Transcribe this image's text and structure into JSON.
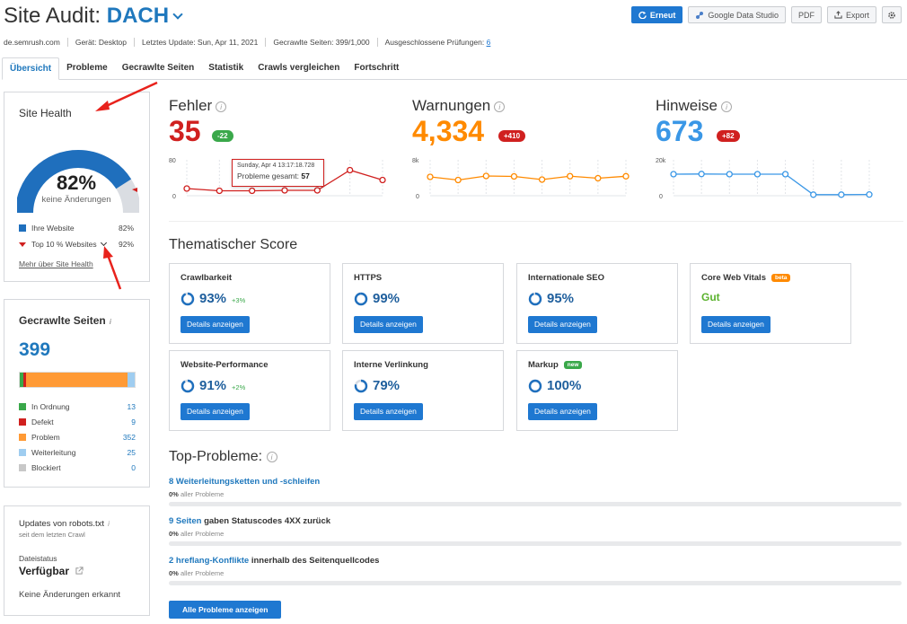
{
  "header": {
    "title_prefix": "Site Audit:",
    "project": "DACH",
    "buttons": {
      "refresh": "Erneut",
      "gds": "Google Data Studio",
      "pdf": "PDF",
      "export": "Export"
    }
  },
  "meta": {
    "domain": "de.semrush.com",
    "device": "Gerät: Desktop",
    "last_update": "Letztes Update: Sun, Apr 11, 2021",
    "crawled": "Gecrawlte Seiten: 399/1,000",
    "excluded_label": "Ausgeschlossene Prüfungen:",
    "excluded_count": "6"
  },
  "tabs": [
    "Übersicht",
    "Probleme",
    "Gecrawlte Seiten",
    "Statistik",
    "Crawls vergleichen",
    "Fortschritt"
  ],
  "site_health": {
    "title": "Site Health",
    "percent": "82%",
    "percent_value": 0.82,
    "subtitle": "keine Änderungen",
    "legend": [
      {
        "label": "Ihre Website",
        "value": "82%"
      },
      {
        "label": "Top 10 % Websites",
        "value": "92%"
      }
    ],
    "link": "Mehr über Site Health"
  },
  "crawled_pages": {
    "title": "Gecrawlte Seiten",
    "info": "i",
    "total": "399",
    "rows": [
      {
        "label": "In Ordnung",
        "value": "13",
        "color": "#3aa84a"
      },
      {
        "label": "Defekt",
        "value": "9",
        "color": "#d0201f"
      },
      {
        "label": "Problem",
        "value": "352",
        "color": "#ff9a35"
      },
      {
        "label": "Weiterleitung",
        "value": "25",
        "color": "#9fcdf0"
      },
      {
        "label": "Blockiert",
        "value": "0",
        "color": "#c8c8c8"
      }
    ]
  },
  "robots": {
    "title": "Updates von robots.txt",
    "info": "i",
    "subtitle": "seit dem letzten Crawl",
    "status_label": "Dateistatus",
    "status_value": "Verfügbar",
    "no_changes": "Keine Änderungen erkannt"
  },
  "stats": {
    "errors": {
      "label": "Fehler",
      "value": "35",
      "badge": "-22",
      "color": "#d0201f",
      "badge_color": "#3aa84a",
      "axis_top": "80",
      "axis_bottom": "0",
      "points": [
        16,
        11,
        11,
        12,
        12,
        57,
        35
      ]
    },
    "warnings": {
      "label": "Warnungen",
      "value": "4,334",
      "badge": "+410",
      "color": "#ff8a00",
      "badge_color": "#d0201f",
      "axis_top": "8k",
      "axis_bottom": "0",
      "points": [
        4200,
        3500,
        4400,
        4300,
        3600,
        4350,
        3900,
        4334
      ]
    },
    "notices": {
      "label": "Hinweise",
      "value": "673",
      "badge": "+82",
      "color": "#3a97e6",
      "badge_color": "#d0201f",
      "axis_top": "20k",
      "axis_bottom": "0",
      "points": [
        12000,
        12100,
        12000,
        12000,
        12000,
        600,
        590,
        673
      ]
    }
  },
  "tooltip": {
    "date": "Sunday, Apr 4 13:17:18.728",
    "label": "Probleme gesamt:",
    "value": "57"
  },
  "thematic": {
    "title": "Thematischer Score",
    "details_label": "Details anzeigen",
    "cards": [
      {
        "name": "Crawlbarkeit",
        "pct": "93%",
        "value": 0.93,
        "delta": "+3%"
      },
      {
        "name": "HTTPS",
        "pct": "99%",
        "value": 0.99,
        "delta": ""
      },
      {
        "name": "Internationale SEO",
        "pct": "95%",
        "value": 0.95,
        "delta": ""
      },
      {
        "name": "Core Web Vitals",
        "tag": "beta",
        "tag_color": "#ff8a00",
        "status": "Gut"
      },
      {
        "name": "Website-Performance",
        "pct": "91%",
        "value": 0.91,
        "delta": "+2%"
      },
      {
        "name": "Interne Verlinkung",
        "pct": "79%",
        "value": 0.79,
        "delta": ""
      },
      {
        "name": "Markup",
        "tag": "new",
        "tag_color": "#3aa84a",
        "pct": "100%",
        "value": 1.0,
        "delta": ""
      }
    ]
  },
  "top_problems": {
    "title": "Top-Probleme:",
    "items": [
      {
        "link": "8 Weiterleitungsketten und -schleifen",
        "rest": "",
        "pct": "0%",
        "sub": "aller Probleme"
      },
      {
        "link": "9 Seiten",
        "rest": " gaben Statuscodes 4XX zurück",
        "pct": "0%",
        "sub": "aller Probleme"
      },
      {
        "link": "2 hreflang-Konflikte",
        "rest": " innerhalb des Seitenquellcodes",
        "pct": "0%",
        "sub": "aller Probleme"
      }
    ],
    "all_button": "Alle Probleme anzeigen"
  }
}
